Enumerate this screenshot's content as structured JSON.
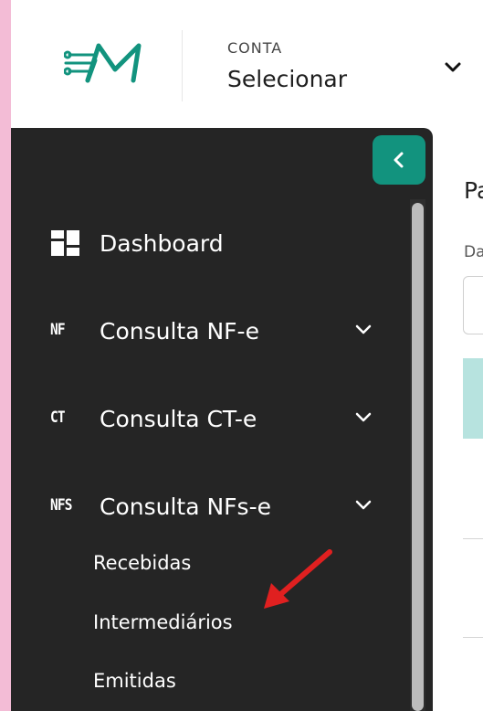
{
  "header": {
    "logo_icon": "circuit-m-logo-icon",
    "account_label": "CONTA",
    "account_value": "Selecionar"
  },
  "sidebar": {
    "collapse_icon": "chevron-left-icon",
    "items": [
      {
        "label": "Dashboard",
        "icon": "dashboard-grid-icon"
      },
      {
        "label": "Consulta NF-e",
        "tag": "NF"
      },
      {
        "label": "Consulta CT-e",
        "tag": "CT"
      },
      {
        "label": "Consulta NFs-e",
        "tag": "NFS",
        "expanded": true,
        "children": [
          "Recebidas",
          "Intermediários",
          "Emitidas"
        ]
      }
    ]
  },
  "main": {
    "title_partial": "Pa",
    "field_label_partial": "Da"
  },
  "annotation": {
    "color": "#e02020",
    "points_to": "Intermediários"
  },
  "colors": {
    "sidebar_bg": "#252525",
    "accent": "#12937e",
    "table_header": "#b7e3df"
  }
}
